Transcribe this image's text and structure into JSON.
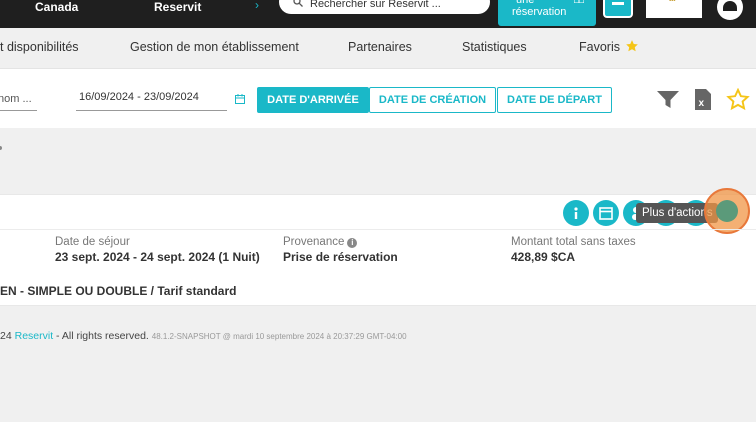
{
  "topbar": {
    "links": [
      "Canada",
      "Reservit"
    ],
    "search_placeholder": "Rechercher sur Reservit ...",
    "new_reservation": [
      "une",
      "réservation"
    ]
  },
  "nav": {
    "items": [
      "t disponibilités",
      "Gestion de mon établissement",
      "Partenaires",
      "Statistiques",
      "Favoris"
    ],
    "accent": "#1ab8c8"
  },
  "filters": {
    "name_value": "nom ...",
    "date_range": "16/09/2024 - 23/09/2024",
    "tabs": [
      "DATE D'ARRIVÉE",
      "DATE DE CRÉATION",
      "DATE DE DÉPART"
    ],
    "active_tab": "DATE D'ARRIVÉE",
    "icons": [
      "filter-icon",
      "excel-export-icon",
      "star-icon"
    ]
  },
  "reservation": {
    "tooltip": "Plus d'actions",
    "action_icons": [
      "info-icon",
      "calendar-icon",
      "user-icon"
    ],
    "stay_label": "Date de séjour",
    "stay_value": "23 sept. 2024 - 24 sept. 2024 (1 Nuit)",
    "source_label": "Provenance",
    "source_value": "Prise de réservation",
    "total_label": "Montant total sans taxes",
    "total_value": "428,89 $CA",
    "room": "EN - SIMPLE OU DOUBLE / Tarif standard"
  },
  "footer": {
    "prefix": "24 ",
    "brand": "Reservit",
    "rights": " - All rights reserved. ",
    "version": "48.1.2-SNAPSHOT @ mardi 10 septembre 2024 à 20:37:29 GMT-04:00"
  }
}
